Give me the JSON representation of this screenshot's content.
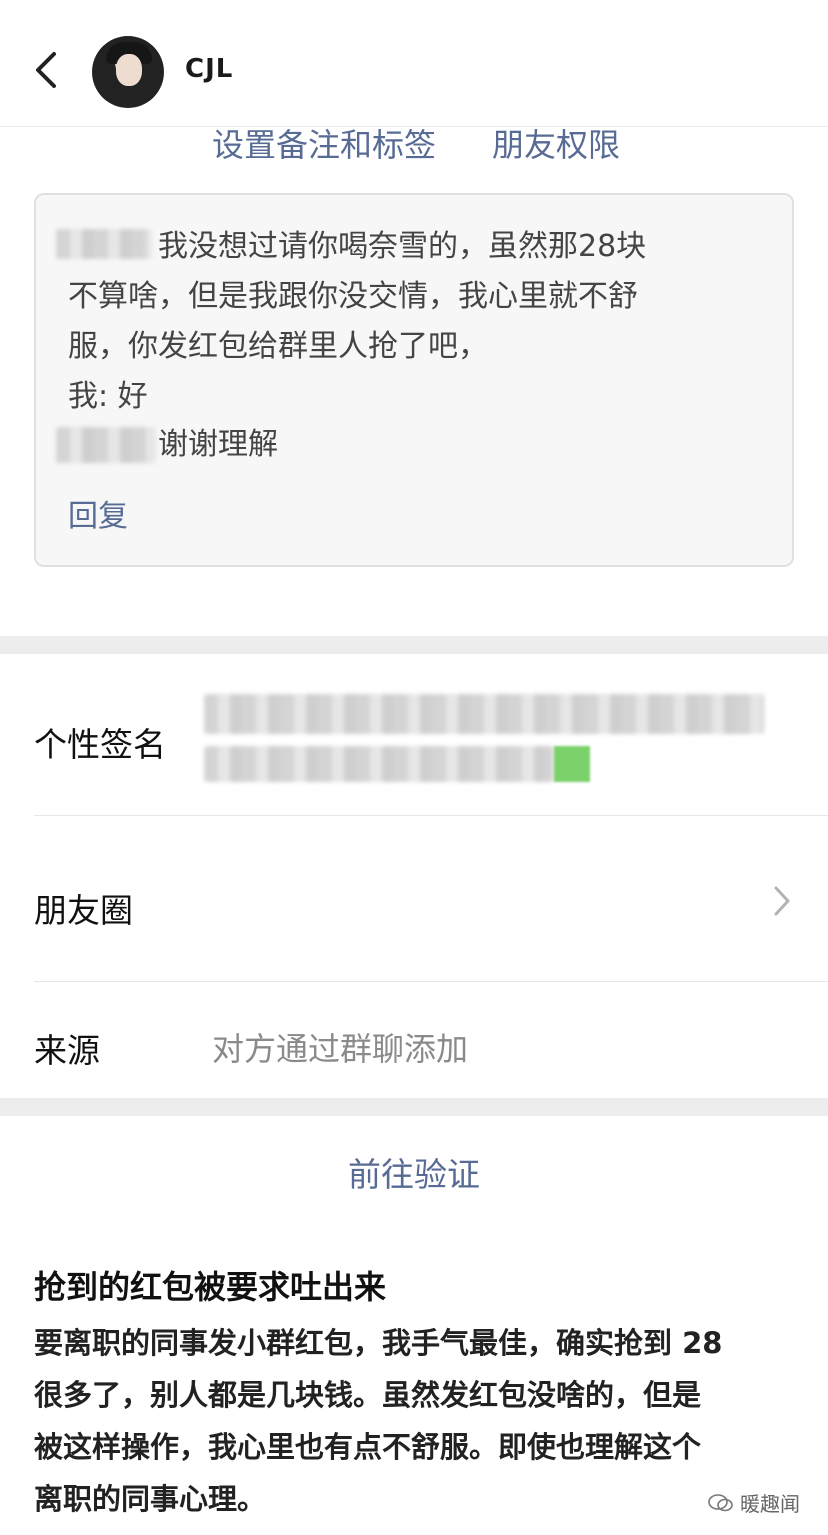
{
  "header": {
    "contact_name": "CJL"
  },
  "links": {
    "remark_label": "设置备注和标签",
    "permission_label": "朋友权限"
  },
  "verification_message": {
    "lines": [
      "我没想过请你喝奈雪的，虽然那28块",
      "不算啥，但是我跟你没交情，我心里就不舒",
      "服，你发红包给群里人抢了吧，",
      "我: 好",
      "谢谢理解"
    ],
    "reply_label": "回复"
  },
  "profile": {
    "signature_label": "个性签名",
    "moments_label": "朋友圈",
    "source_label": "来源",
    "source_value": "对方通过群聊添加"
  },
  "actions": {
    "goto_verify_label": "前往验证"
  },
  "article": {
    "title": "抢到的红包被要求吐出来",
    "lines": [
      "要离职的同事发小群红包，我手气最佳，确实抢到 28",
      "很多了，别人都是几块钱。虽然发红包没啥的，但是",
      "被这样操作，我心里也有点不舒服。即使也理解这个",
      "离职的同事心理。"
    ]
  },
  "watermark": {
    "text": "暖趣闻"
  }
}
